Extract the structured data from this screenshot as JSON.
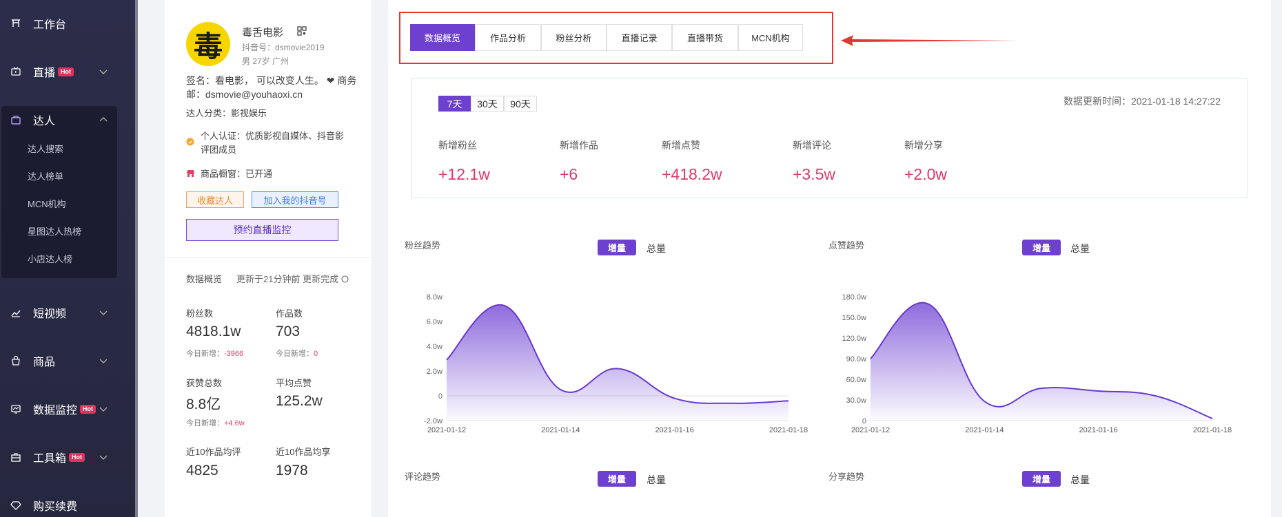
{
  "sidebar": {
    "items": [
      {
        "label": "工作台",
        "icon": "workbench-icon"
      },
      {
        "label": "直播",
        "badge": "Hot",
        "icon": "live-icon"
      },
      {
        "label": "达人",
        "icon": "bag-icon"
      },
      {
        "label": "短视频",
        "icon": "trend-icon"
      },
      {
        "label": "商品",
        "icon": "shopping-bag-icon"
      },
      {
        "label": "数据监控",
        "badge": "Hot",
        "icon": "monitor-icon"
      },
      {
        "label": "工具箱",
        "badge": "Hot",
        "icon": "toolbox-icon"
      },
      {
        "label": "购买续费",
        "icon": "diamond-icon"
      }
    ],
    "subitems": [
      "达人搜索",
      "达人榜单",
      "MCN机构",
      "星图达人热榜",
      "小店达人榜"
    ]
  },
  "profile": {
    "avatar_char": "毒",
    "name": "毒舌电影",
    "douyin_id": "抖音号：dsmovie2019",
    "meta": "男  27岁   广州",
    "signature_line1": "签名：看电影， 可以改变人生。 ❤ 商务",
    "signature_line2": "邮：dsmovie@youhaoxi.cn",
    "category": "达人分类：影视娱乐",
    "cert_line1": "个人认证：优质影视自媒体、抖音影",
    "cert_line2": "评团成员",
    "shop": "商品橱窗：已开通",
    "btn_collect": "收藏达人",
    "btn_join": "加入我的抖音号",
    "btn_monitor": "预约直播监控",
    "overview_title": "数据概览",
    "overview_update": "更新于21分钟前 更新完成",
    "stats": [
      {
        "label": "粉丝数",
        "value": "4818.1w",
        "delta_prefix": "今日新增：",
        "delta": "-3966"
      },
      {
        "label": "作品数",
        "value": "703",
        "delta_prefix": "今日新增：",
        "delta": "0"
      },
      {
        "label": "获赞总数",
        "value": "8.8亿",
        "delta_prefix": "今日新增：",
        "delta": "+4.6w"
      },
      {
        "label": "平均点赞",
        "value": "125.2w"
      },
      {
        "label": "近10作品均评",
        "value": "4825"
      },
      {
        "label": "近10作品均享",
        "value": "1978"
      }
    ]
  },
  "main": {
    "tabs": [
      "数据概览",
      "作品分析",
      "粉丝分析",
      "直播记录",
      "直播带货",
      "MCN机构"
    ],
    "active_tab": 0,
    "ranges": [
      "7天",
      "30天",
      "90天"
    ],
    "update_time": "数据更新时间：2021-01-18 14:27:22",
    "metrics": [
      {
        "label": "新增粉丝",
        "value": "+12.1w"
      },
      {
        "label": "新增作品",
        "value": "+6"
      },
      {
        "label": "新增点赞",
        "value": "+418.2w"
      },
      {
        "label": "新增评论",
        "value": "+3.5w"
      },
      {
        "label": "新增分享",
        "value": "+2.0w"
      }
    ],
    "toggle_on": "增量",
    "toggle_off": "总量"
  },
  "colors": {
    "accent": "#6e40cf",
    "highlight": "#e0386a",
    "sidebar": "#2c2d4a",
    "annotation": "#e53535"
  },
  "chart_data": [
    {
      "type": "area",
      "title": "粉丝趋势",
      "x": [
        "2021-01-12",
        "2021-01-13",
        "2021-01-14",
        "2021-01-15",
        "2021-01-16",
        "2021-01-17",
        "2021-01-18"
      ],
      "xticks": [
        "2021-01-12",
        "2021-01-14",
        "2021-01-16",
        "2021-01-18"
      ],
      "values": [
        2.9,
        7.3,
        0.5,
        2.2,
        -0.2,
        -0.6,
        -0.4
      ],
      "ylim": [
        -2.0,
        8.0
      ],
      "yticks": [
        -2.0,
        0,
        2.0,
        4.0,
        6.0,
        8.0
      ],
      "yticklabels": [
        "-2.0w",
        "0",
        "2.0w",
        "4.0w",
        "6.0w",
        "8.0w"
      ]
    },
    {
      "type": "area",
      "title": "点赞趋势",
      "x": [
        "2021-01-12",
        "2021-01-13",
        "2021-01-14",
        "2021-01-15",
        "2021-01-16",
        "2021-01-17",
        "2021-01-18"
      ],
      "xticks": [
        "2021-01-12",
        "2021-01-14",
        "2021-01-16",
        "2021-01-18"
      ],
      "values": [
        90,
        170,
        28,
        47,
        43,
        36,
        3
      ],
      "ylim": [
        0,
        180
      ],
      "yticks": [
        0,
        30,
        60,
        90,
        120,
        150,
        180
      ],
      "yticklabels": [
        "0",
        "30.0w",
        "60.0w",
        "90.0w",
        "120.0w",
        "150.0w",
        "180.0w"
      ]
    },
    {
      "type": "area",
      "title": "评论趋势"
    },
    {
      "type": "area",
      "title": "分享趋势"
    }
  ]
}
